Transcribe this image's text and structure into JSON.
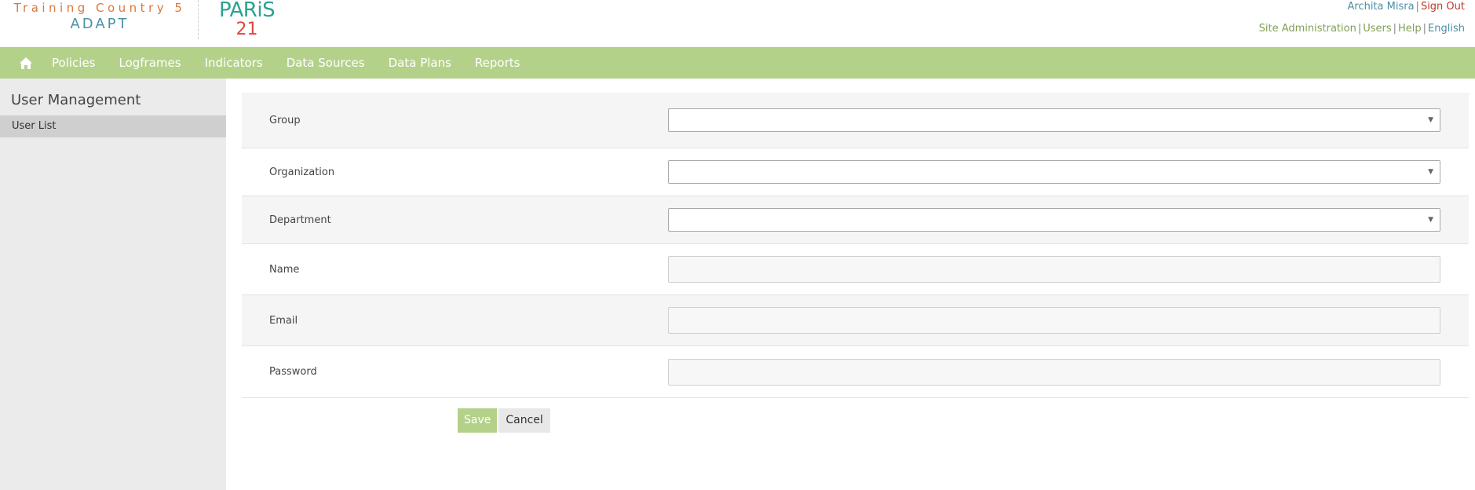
{
  "brand": {
    "title": "Training Country 5",
    "subtitle": "ADAPT"
  },
  "logo": {
    "top": "PARiS",
    "bottom": "21"
  },
  "user_menu": {
    "user_name": "Archita Misra",
    "sign_out": "Sign Out"
  },
  "admin_menu": {
    "site_admin": "Site Administration",
    "users": "Users",
    "help": "Help",
    "language": "English"
  },
  "nav": {
    "items": [
      "Policies",
      "Logframes",
      "Indicators",
      "Data Sources",
      "Data Plans",
      "Reports"
    ]
  },
  "sidebar": {
    "title": "User Management",
    "items": [
      "User List"
    ]
  },
  "form": {
    "group_label": "Group",
    "group_value": "",
    "organization_label": "Organization",
    "organization_value": "",
    "department_label": "Department",
    "department_value": "",
    "name_label": "Name",
    "name_value": "",
    "email_label": "Email",
    "email_value": "",
    "password_label": "Password",
    "password_value": "",
    "save_label": "Save",
    "cancel_label": "Cancel"
  },
  "colors": {
    "accent_green": "#b4d18a",
    "brand_orange": "#d9783a",
    "brand_blue": "#4d8fa6",
    "sign_out_red": "#c0392b"
  }
}
